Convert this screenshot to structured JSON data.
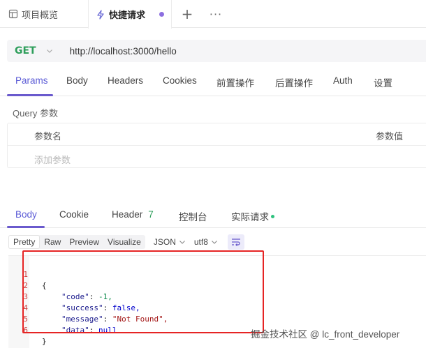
{
  "tabs": {
    "overview_label": "项目概览",
    "quick_label": "快捷请求",
    "add_symbol": "+",
    "more_symbol": "···"
  },
  "request": {
    "method": "GET",
    "url": "http://localhost:3000/hello"
  },
  "request_tabs": [
    {
      "label": "Params",
      "active": true
    },
    {
      "label": "Body"
    },
    {
      "label": "Headers"
    },
    {
      "label": "Cookies"
    },
    {
      "label": "前置操作"
    },
    {
      "label": "后置操作"
    },
    {
      "label": "Auth"
    },
    {
      "label": "设置"
    }
  ],
  "query": {
    "section_label": "Query 参数",
    "col_name": "参数名",
    "col_value": "参数值",
    "add_placeholder": "添加参数"
  },
  "response_tabs": {
    "body": "Body",
    "cookie": "Cookie",
    "header": "Header",
    "header_count": "7",
    "console": "控制台",
    "actual_request": "实际请求"
  },
  "format": {
    "modes": [
      "Pretty",
      "Raw",
      "Preview",
      "Visualize"
    ],
    "active_mode": "Pretty",
    "lang": "JSON",
    "encoding": "utf8"
  },
  "response_body": {
    "lines": [
      {
        "n": "1",
        "text": "{"
      },
      {
        "n": "2",
        "key": "\"code\"",
        "value": "-1,",
        "vtype": "num"
      },
      {
        "n": "3",
        "key": "\"success\"",
        "value": "false,",
        "vtype": "kw"
      },
      {
        "n": "4",
        "key": "\"message\"",
        "value": "\"Not Found\",",
        "vtype": "str"
      },
      {
        "n": "5",
        "key": "\"data\"",
        "value": "null",
        "vtype": "kw"
      },
      {
        "n": "6",
        "text": "}"
      }
    ]
  },
  "watermark": "掘金技术社区 @ lc_front_developer",
  "colors": {
    "accent": "#5b5bd6",
    "method_get": "#2e9e5b",
    "highlight_border": "#e62424"
  }
}
